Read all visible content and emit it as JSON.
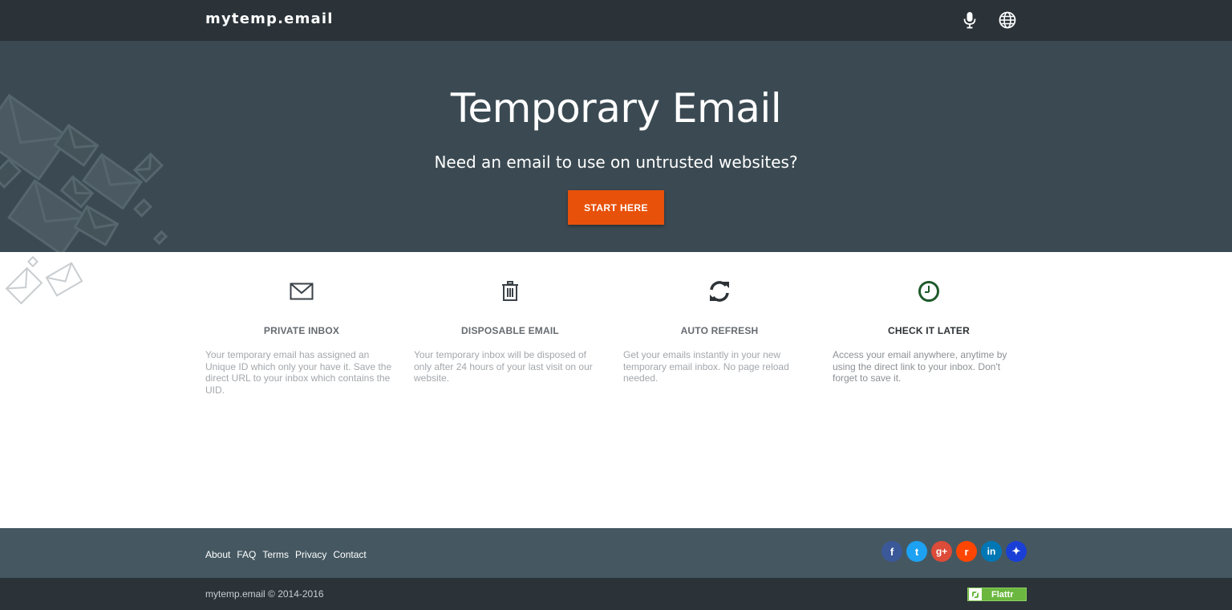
{
  "navbar": {
    "brand": "mytemp.email",
    "icons": [
      "microphone-icon",
      "globe-icon"
    ]
  },
  "hero": {
    "title": "Temporary Email",
    "subtitle": "Need an email to use on untrusted websites?",
    "cta_label": "START HERE",
    "cta_color": "#e8510a",
    "background_color": "#3b4a52"
  },
  "features": [
    {
      "icon": "envelope-icon",
      "title": "PRIVATE INBOX",
      "text": "Your temporary email has assigned an Unique ID which only your have it. Save the direct URL to your inbox which contains the UID."
    },
    {
      "icon": "trash-icon",
      "title": "DISPOSABLE EMAIL",
      "text": "Your temporary inbox will be disposed of only after 24 hours of your last visit on our website."
    },
    {
      "icon": "refresh-icon",
      "title": "AUTO REFRESH",
      "text": "Get your emails instantly in your new temporary email inbox. No page reload needed."
    },
    {
      "icon": "clock-icon",
      "title": "CHECK IT LATER",
      "text": "Access your email anywhere, anytime by using the direct link to your inbox. Don't forget to save it."
    }
  ],
  "footer": {
    "links": [
      "About",
      "FAQ",
      "Terms",
      "Privacy",
      "Contact"
    ],
    "social": [
      {
        "icon": "facebook-icon",
        "glyph": "f",
        "color": "#3b5998"
      },
      {
        "icon": "twitter-icon",
        "glyph": "t",
        "color": "#1da1f2"
      },
      {
        "icon": "google-plus-icon",
        "glyph": "g+",
        "color": "#dd4b39"
      },
      {
        "icon": "reddit-icon",
        "glyph": "r",
        "color": "#ff4500"
      },
      {
        "icon": "linkedin-icon",
        "glyph": "in",
        "color": "#0077b5"
      },
      {
        "icon": "pin-icon",
        "glyph": "✦",
        "color": "#1a3fd6"
      }
    ],
    "copyright": "mytemp.email © 2014-2016",
    "flattr_label": "Flattr"
  }
}
